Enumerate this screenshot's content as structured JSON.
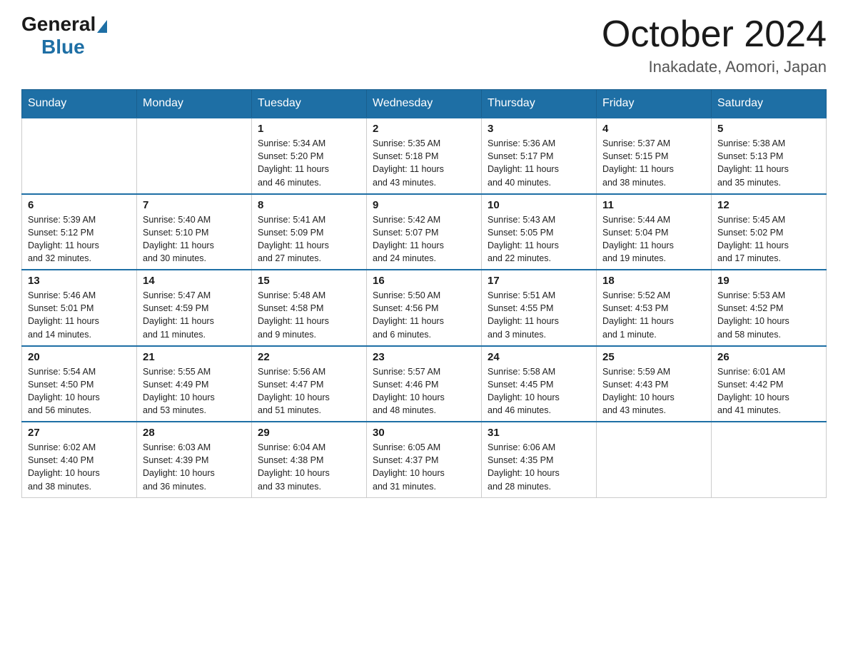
{
  "logo": {
    "general": "General",
    "blue": "Blue"
  },
  "title": "October 2024",
  "location": "Inakadate, Aomori, Japan",
  "days_of_week": [
    "Sunday",
    "Monday",
    "Tuesday",
    "Wednesday",
    "Thursday",
    "Friday",
    "Saturday"
  ],
  "weeks": [
    [
      {
        "day": "",
        "info": ""
      },
      {
        "day": "",
        "info": ""
      },
      {
        "day": "1",
        "info": "Sunrise: 5:34 AM\nSunset: 5:20 PM\nDaylight: 11 hours\nand 46 minutes."
      },
      {
        "day": "2",
        "info": "Sunrise: 5:35 AM\nSunset: 5:18 PM\nDaylight: 11 hours\nand 43 minutes."
      },
      {
        "day": "3",
        "info": "Sunrise: 5:36 AM\nSunset: 5:17 PM\nDaylight: 11 hours\nand 40 minutes."
      },
      {
        "day": "4",
        "info": "Sunrise: 5:37 AM\nSunset: 5:15 PM\nDaylight: 11 hours\nand 38 minutes."
      },
      {
        "day": "5",
        "info": "Sunrise: 5:38 AM\nSunset: 5:13 PM\nDaylight: 11 hours\nand 35 minutes."
      }
    ],
    [
      {
        "day": "6",
        "info": "Sunrise: 5:39 AM\nSunset: 5:12 PM\nDaylight: 11 hours\nand 32 minutes."
      },
      {
        "day": "7",
        "info": "Sunrise: 5:40 AM\nSunset: 5:10 PM\nDaylight: 11 hours\nand 30 minutes."
      },
      {
        "day": "8",
        "info": "Sunrise: 5:41 AM\nSunset: 5:09 PM\nDaylight: 11 hours\nand 27 minutes."
      },
      {
        "day": "9",
        "info": "Sunrise: 5:42 AM\nSunset: 5:07 PM\nDaylight: 11 hours\nand 24 minutes."
      },
      {
        "day": "10",
        "info": "Sunrise: 5:43 AM\nSunset: 5:05 PM\nDaylight: 11 hours\nand 22 minutes."
      },
      {
        "day": "11",
        "info": "Sunrise: 5:44 AM\nSunset: 5:04 PM\nDaylight: 11 hours\nand 19 minutes."
      },
      {
        "day": "12",
        "info": "Sunrise: 5:45 AM\nSunset: 5:02 PM\nDaylight: 11 hours\nand 17 minutes."
      }
    ],
    [
      {
        "day": "13",
        "info": "Sunrise: 5:46 AM\nSunset: 5:01 PM\nDaylight: 11 hours\nand 14 minutes."
      },
      {
        "day": "14",
        "info": "Sunrise: 5:47 AM\nSunset: 4:59 PM\nDaylight: 11 hours\nand 11 minutes."
      },
      {
        "day": "15",
        "info": "Sunrise: 5:48 AM\nSunset: 4:58 PM\nDaylight: 11 hours\nand 9 minutes."
      },
      {
        "day": "16",
        "info": "Sunrise: 5:50 AM\nSunset: 4:56 PM\nDaylight: 11 hours\nand 6 minutes."
      },
      {
        "day": "17",
        "info": "Sunrise: 5:51 AM\nSunset: 4:55 PM\nDaylight: 11 hours\nand 3 minutes."
      },
      {
        "day": "18",
        "info": "Sunrise: 5:52 AM\nSunset: 4:53 PM\nDaylight: 11 hours\nand 1 minute."
      },
      {
        "day": "19",
        "info": "Sunrise: 5:53 AM\nSunset: 4:52 PM\nDaylight: 10 hours\nand 58 minutes."
      }
    ],
    [
      {
        "day": "20",
        "info": "Sunrise: 5:54 AM\nSunset: 4:50 PM\nDaylight: 10 hours\nand 56 minutes."
      },
      {
        "day": "21",
        "info": "Sunrise: 5:55 AM\nSunset: 4:49 PM\nDaylight: 10 hours\nand 53 minutes."
      },
      {
        "day": "22",
        "info": "Sunrise: 5:56 AM\nSunset: 4:47 PM\nDaylight: 10 hours\nand 51 minutes."
      },
      {
        "day": "23",
        "info": "Sunrise: 5:57 AM\nSunset: 4:46 PM\nDaylight: 10 hours\nand 48 minutes."
      },
      {
        "day": "24",
        "info": "Sunrise: 5:58 AM\nSunset: 4:45 PM\nDaylight: 10 hours\nand 46 minutes."
      },
      {
        "day": "25",
        "info": "Sunrise: 5:59 AM\nSunset: 4:43 PM\nDaylight: 10 hours\nand 43 minutes."
      },
      {
        "day": "26",
        "info": "Sunrise: 6:01 AM\nSunset: 4:42 PM\nDaylight: 10 hours\nand 41 minutes."
      }
    ],
    [
      {
        "day": "27",
        "info": "Sunrise: 6:02 AM\nSunset: 4:40 PM\nDaylight: 10 hours\nand 38 minutes."
      },
      {
        "day": "28",
        "info": "Sunrise: 6:03 AM\nSunset: 4:39 PM\nDaylight: 10 hours\nand 36 minutes."
      },
      {
        "day": "29",
        "info": "Sunrise: 6:04 AM\nSunset: 4:38 PM\nDaylight: 10 hours\nand 33 minutes."
      },
      {
        "day": "30",
        "info": "Sunrise: 6:05 AM\nSunset: 4:37 PM\nDaylight: 10 hours\nand 31 minutes."
      },
      {
        "day": "31",
        "info": "Sunrise: 6:06 AM\nSunset: 4:35 PM\nDaylight: 10 hours\nand 28 minutes."
      },
      {
        "day": "",
        "info": ""
      },
      {
        "day": "",
        "info": ""
      }
    ]
  ]
}
